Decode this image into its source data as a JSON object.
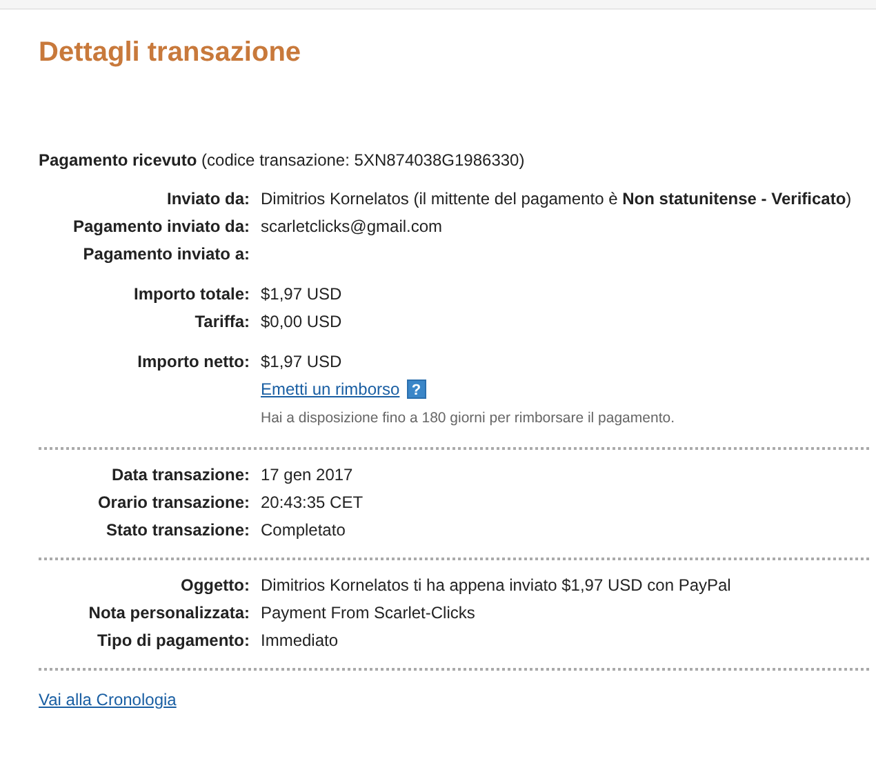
{
  "title": "Dettagli transazione",
  "header": {
    "label": "Pagamento ricevuto",
    "detail": "(codice transazione: 5XN874038G1986330)"
  },
  "sections": [
    {
      "groups": [
        {
          "rows": [
            {
              "kind": "field",
              "label": "Inviato da:",
              "value": "Dimitrios Kornelatos (il mittente del pagamento è **Non statunitense - Verificato**)"
            },
            {
              "kind": "field",
              "label": "Pagamento inviato da:",
              "value": "scarletclicks@gmail.com"
            },
            {
              "kind": "field",
              "label": "Pagamento inviato a:"
            }
          ]
        },
        {
          "rows": [
            {
              "kind": "field",
              "label": "Importo totale:",
              "value": "$1,97 USD"
            },
            {
              "kind": "field",
              "label": "Tariffa:",
              "value": "$0,00 USD"
            }
          ]
        },
        {
          "rows": [
            {
              "kind": "field",
              "label": "Importo netto:",
              "value": "$1,97 USD"
            },
            {
              "kind": "link",
              "value": "Emetti un rimborso",
              "help": "?"
            },
            {
              "kind": "note",
              "value": "Hai a disposizione fino a 180 giorni per rimborsare il pagamento."
            }
          ]
        }
      ]
    },
    {
      "groups": [
        {
          "rows": [
            {
              "kind": "field",
              "label": "Data transazione:",
              "value": "17 gen 2017"
            },
            {
              "kind": "field",
              "label": "Orario transazione:",
              "value": "20:43:35 CET"
            },
            {
              "kind": "field",
              "label": "Stato transazione:",
              "value": "Completato"
            }
          ]
        }
      ]
    },
    {
      "groups": [
        {
          "rows": [
            {
              "kind": "field",
              "label": "Oggetto:",
              "value": "Dimitrios Kornelatos ti ha appena inviato $1,97 USD con PayPal"
            },
            {
              "kind": "field",
              "label": "Nota personalizzata:",
              "value": "Payment From Scarlet-Clicks"
            },
            {
              "kind": "field",
              "label": "Tipo di pagamento:",
              "value": "Immediato"
            }
          ]
        }
      ]
    }
  ],
  "footer_link": "Vai alla Cronologia"
}
